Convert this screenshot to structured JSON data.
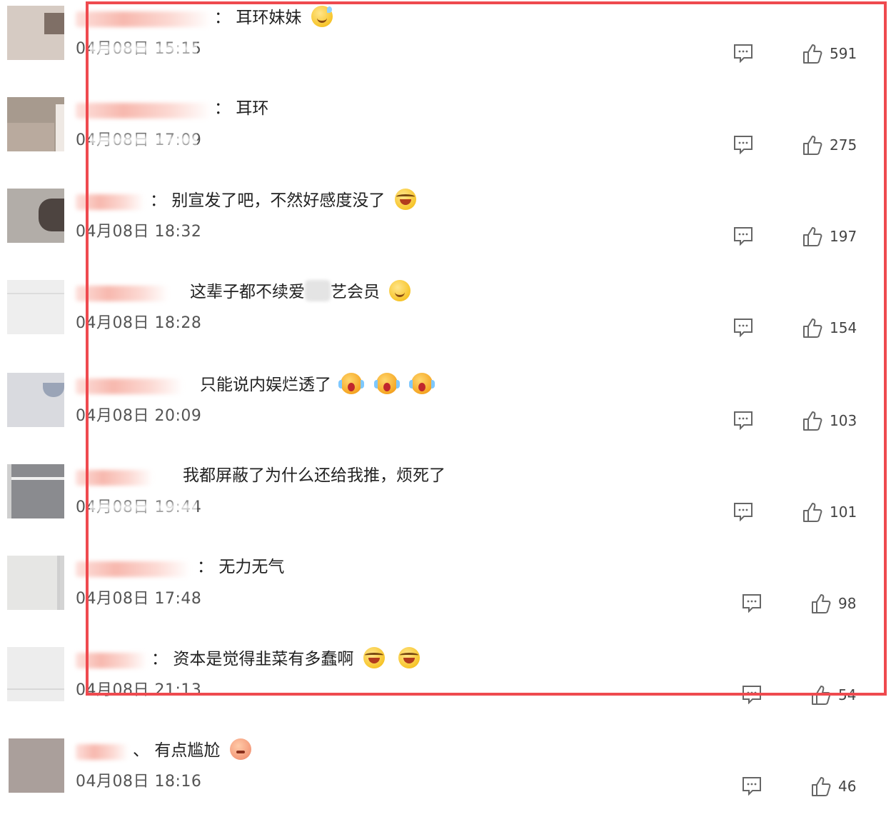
{
  "comments": [
    {
      "sep": "：",
      "text": "耳环妹妹",
      "emojis": [
        "sweat"
      ],
      "date": "04月08日 15:15",
      "likes": "591"
    },
    {
      "sep": "：",
      "text": "耳环",
      "emojis": [],
      "date": "04月08日 17:09",
      "likes": "275"
    },
    {
      "sep": "：",
      "text": "别宣发了吧，不然好感度没了",
      "emojis": [
        "laugh"
      ],
      "date": "04月08日 18:32",
      "likes": "197"
    },
    {
      "sep": "",
      "text_before": "这辈子都不续爱",
      "text_after": "艺会员",
      "emojis": [
        "smile"
      ],
      "date": "04月08日 18:28",
      "likes": "154"
    },
    {
      "sep": "",
      "text": "只能说内娱烂透了",
      "emojis": [
        "shock",
        "shock",
        "shock"
      ],
      "date": "04月08日 20:09",
      "likes": "103"
    },
    {
      "sep": "",
      "text": "我都屏蔽了为什么还给我推，烦死了",
      "emojis": [],
      "date": "04月08日 19:44",
      "likes": "101"
    },
    {
      "sep": "：",
      "text": "无力无气",
      "emojis": [],
      "date": "04月08日 17:48",
      "likes": "98"
    },
    {
      "sep": "：",
      "text": "资本是觉得韭菜有多蠢啊",
      "emojis": [
        "laugh",
        "laugh"
      ],
      "date": "04月08日 21:13",
      "likes": "54"
    },
    {
      "sep": "、",
      "text": "有点尴尬",
      "emojis": [
        "awkward"
      ],
      "date": "04月08日 18:16",
      "likes": "46"
    }
  ],
  "icons": {
    "reply": "comment-icon",
    "like": "thumbs-up-icon"
  },
  "colors": {
    "highlight_box": "#ef4a4f",
    "text": "#222222",
    "meta": "#555555"
  }
}
